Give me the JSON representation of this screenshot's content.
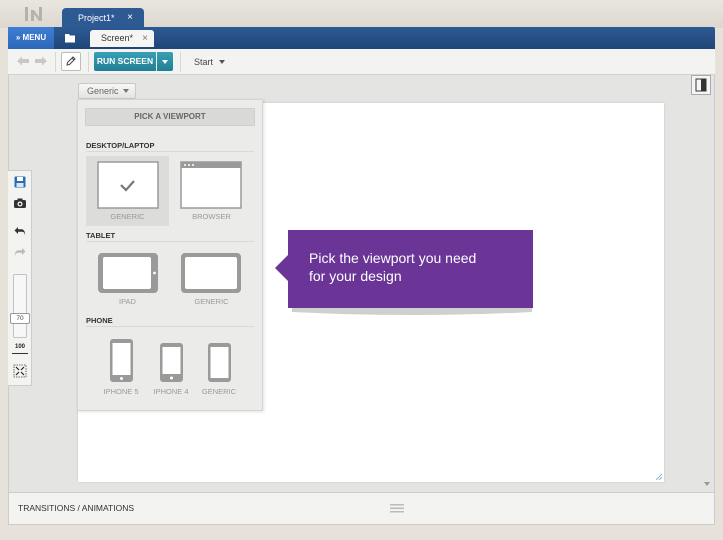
{
  "tabs": {
    "project_label": "Project1*",
    "project_close": "×",
    "screen_label": "Screen*",
    "screen_close": "×"
  },
  "menu": {
    "label": "» MENU"
  },
  "toolbar": {
    "run_label": "RUN SCREEN",
    "start_label": "Start"
  },
  "viewport_select": {
    "value": "Generic"
  },
  "viewport_panel": {
    "pick_label": "PICK A VIEWPORT",
    "sections": [
      {
        "title": "DESKTOP/LAPTOP",
        "items": [
          "GENERIC",
          "BROWSER"
        ],
        "selected": "GENERIC"
      },
      {
        "title": "TABLET",
        "items": [
          "IPAD",
          "GENERIC"
        ]
      },
      {
        "title": "PHONE",
        "items": [
          "IPHONE 5",
          "IPHONE 4",
          "GENERIC"
        ]
      }
    ]
  },
  "zoom": {
    "value": "70",
    "reset_label": "100"
  },
  "callout": {
    "line1": "Pick the viewport you need",
    "line2": "for your design"
  },
  "bottom": {
    "transitions_label": "TRANSITIONS / ANIMATIONS"
  },
  "colors": {
    "brand_blue": "#2d5a94",
    "menu_blue": "#3c7fd6",
    "run_teal": "#2a90a5",
    "callout_purple": "#6a3596"
  }
}
